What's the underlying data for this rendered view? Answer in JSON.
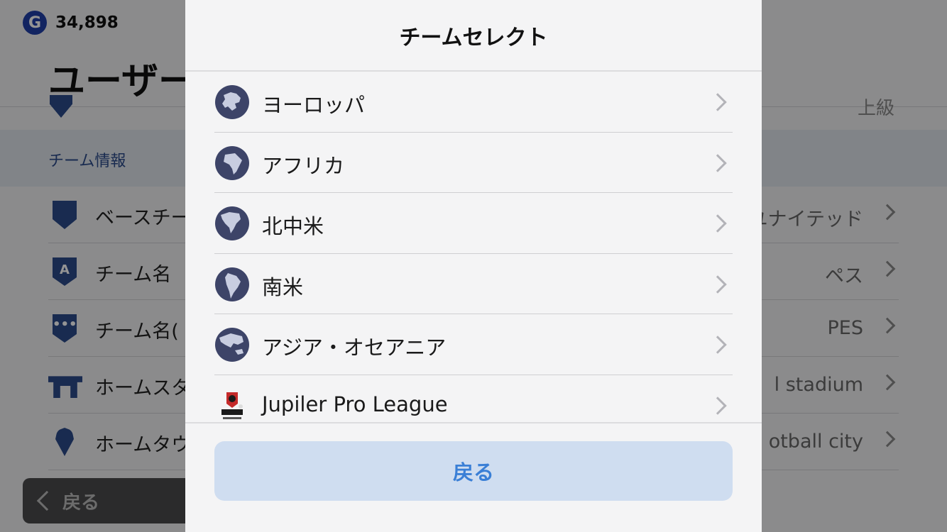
{
  "background": {
    "coins": {
      "symbol": "G",
      "amount": "34,898"
    },
    "title": "ユーザー",
    "partial_row_right": "上級",
    "section_header": "チーム情報",
    "rows": [
      {
        "label": "ベースチー",
        "value": "ユナイテッド",
        "icon": "shield-icon"
      },
      {
        "label": "チーム名",
        "value": "ペス",
        "icon": "team-name-icon"
      },
      {
        "label": "チーム名(",
        "value": "PES",
        "icon": "team-abbrev-icon"
      },
      {
        "label": "ホームスタ",
        "value": "l stadium",
        "icon": "stadium-icon"
      },
      {
        "label": "ホームタウ",
        "value": "otball city",
        "icon": "location-pin-icon"
      }
    ],
    "back_label": "戻る"
  },
  "modal": {
    "title": "チームセレクト",
    "items": [
      {
        "label": "ヨーロッパ",
        "icon": "globe-europe-icon"
      },
      {
        "label": "アフリカ",
        "icon": "globe-africa-icon"
      },
      {
        "label": "北中米",
        "icon": "globe-north-america-icon"
      },
      {
        "label": "南米",
        "icon": "globe-south-america-icon"
      },
      {
        "label": "アジア・オセアニア",
        "icon": "globe-asia-oceania-icon"
      },
      {
        "label": "Jupiler Pro League",
        "icon": "jupiler-pro-league-logo"
      }
    ],
    "back_label": "戻る"
  },
  "colors": {
    "accent_blue": "#3a7fd6",
    "back_button_bg": "#cfddf0",
    "globe_bg": "#3d4468"
  }
}
